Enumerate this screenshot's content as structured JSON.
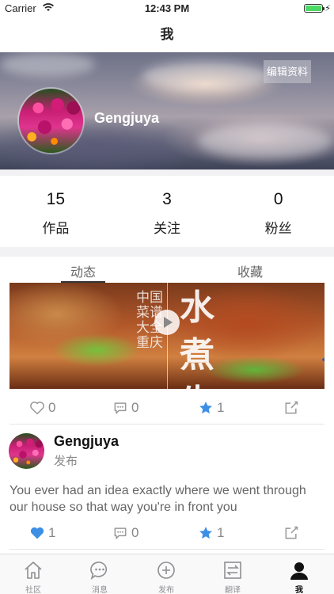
{
  "status_bar": {
    "carrier": "Carrier",
    "time": "12:43 PM"
  },
  "nav": {
    "title": "我"
  },
  "profile": {
    "name": "Gengjuya",
    "edit_label": "编辑资料"
  },
  "stats": [
    {
      "value": "15",
      "label": "作品"
    },
    {
      "value": "3",
      "label": "关注"
    },
    {
      "value": "0",
      "label": "粉丝"
    }
  ],
  "tabs": [
    {
      "label": "动态",
      "active": true
    },
    {
      "label": "收藏",
      "active": false
    }
  ],
  "video": {
    "calligraphy_main": "水煮牛肉",
    "calligraphy_side": "中国菜谱大全 重庆"
  },
  "posts": [
    {
      "like_count": "0",
      "comment_count": "0",
      "fav_count": "1",
      "liked": false,
      "favorited": true
    },
    {
      "author": "Gengjuya",
      "action": "发布",
      "text": "You ever had an idea exactly where we went through our house so that way you're in front you",
      "like_count": "1",
      "comment_count": "0",
      "fav_count": "1",
      "liked": true,
      "favorited": true
    }
  ],
  "tabbar": [
    {
      "label": "社区",
      "icon": "home-icon",
      "active": false
    },
    {
      "label": "消息",
      "icon": "chat-bubble-icon",
      "active": false
    },
    {
      "label": "发布",
      "icon": "plus-circle-icon",
      "active": false
    },
    {
      "label": "翻译",
      "icon": "translate-icon",
      "active": false
    },
    {
      "label": "我",
      "icon": "person-icon",
      "active": true
    }
  ],
  "colors": {
    "accent_blue": "#3d8fe6",
    "active_text": "#111111",
    "inactive_text": "#8e8e93"
  }
}
